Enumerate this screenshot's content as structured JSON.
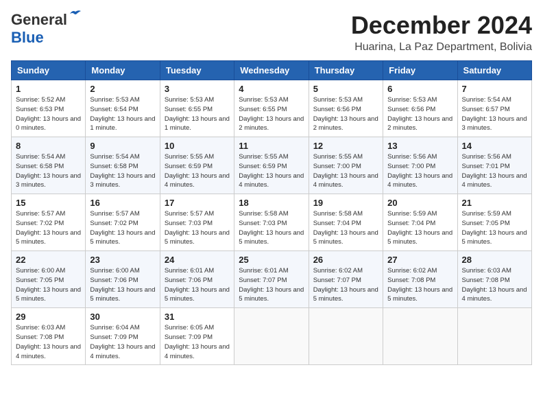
{
  "logo": {
    "line1": "General",
    "line2": "Blue"
  },
  "title": "December 2024",
  "location": "Huarina, La Paz Department, Bolivia",
  "days_of_week": [
    "Sunday",
    "Monday",
    "Tuesday",
    "Wednesday",
    "Thursday",
    "Friday",
    "Saturday"
  ],
  "weeks": [
    [
      {
        "day": "1",
        "sunrise": "5:52 AM",
        "sunset": "6:53 PM",
        "daylight": "13 hours and 0 minutes."
      },
      {
        "day": "2",
        "sunrise": "5:53 AM",
        "sunset": "6:54 PM",
        "daylight": "13 hours and 1 minute."
      },
      {
        "day": "3",
        "sunrise": "5:53 AM",
        "sunset": "6:55 PM",
        "daylight": "13 hours and 1 minute."
      },
      {
        "day": "4",
        "sunrise": "5:53 AM",
        "sunset": "6:55 PM",
        "daylight": "13 hours and 2 minutes."
      },
      {
        "day": "5",
        "sunrise": "5:53 AM",
        "sunset": "6:56 PM",
        "daylight": "13 hours and 2 minutes."
      },
      {
        "day": "6",
        "sunrise": "5:53 AM",
        "sunset": "6:56 PM",
        "daylight": "13 hours and 2 minutes."
      },
      {
        "day": "7",
        "sunrise": "5:54 AM",
        "sunset": "6:57 PM",
        "daylight": "13 hours and 3 minutes."
      }
    ],
    [
      {
        "day": "8",
        "sunrise": "5:54 AM",
        "sunset": "6:58 PM",
        "daylight": "13 hours and 3 minutes."
      },
      {
        "day": "9",
        "sunrise": "5:54 AM",
        "sunset": "6:58 PM",
        "daylight": "13 hours and 3 minutes."
      },
      {
        "day": "10",
        "sunrise": "5:55 AM",
        "sunset": "6:59 PM",
        "daylight": "13 hours and 4 minutes."
      },
      {
        "day": "11",
        "sunrise": "5:55 AM",
        "sunset": "6:59 PM",
        "daylight": "13 hours and 4 minutes."
      },
      {
        "day": "12",
        "sunrise": "5:55 AM",
        "sunset": "7:00 PM",
        "daylight": "13 hours and 4 minutes."
      },
      {
        "day": "13",
        "sunrise": "5:56 AM",
        "sunset": "7:00 PM",
        "daylight": "13 hours and 4 minutes."
      },
      {
        "day": "14",
        "sunrise": "5:56 AM",
        "sunset": "7:01 PM",
        "daylight": "13 hours and 4 minutes."
      }
    ],
    [
      {
        "day": "15",
        "sunrise": "5:57 AM",
        "sunset": "7:02 PM",
        "daylight": "13 hours and 5 minutes."
      },
      {
        "day": "16",
        "sunrise": "5:57 AM",
        "sunset": "7:02 PM",
        "daylight": "13 hours and 5 minutes."
      },
      {
        "day": "17",
        "sunrise": "5:57 AM",
        "sunset": "7:03 PM",
        "daylight": "13 hours and 5 minutes."
      },
      {
        "day": "18",
        "sunrise": "5:58 AM",
        "sunset": "7:03 PM",
        "daylight": "13 hours and 5 minutes."
      },
      {
        "day": "19",
        "sunrise": "5:58 AM",
        "sunset": "7:04 PM",
        "daylight": "13 hours and 5 minutes."
      },
      {
        "day": "20",
        "sunrise": "5:59 AM",
        "sunset": "7:04 PM",
        "daylight": "13 hours and 5 minutes."
      },
      {
        "day": "21",
        "sunrise": "5:59 AM",
        "sunset": "7:05 PM",
        "daylight": "13 hours and 5 minutes."
      }
    ],
    [
      {
        "day": "22",
        "sunrise": "6:00 AM",
        "sunset": "7:05 PM",
        "daylight": "13 hours and 5 minutes."
      },
      {
        "day": "23",
        "sunrise": "6:00 AM",
        "sunset": "7:06 PM",
        "daylight": "13 hours and 5 minutes."
      },
      {
        "day": "24",
        "sunrise": "6:01 AM",
        "sunset": "7:06 PM",
        "daylight": "13 hours and 5 minutes."
      },
      {
        "day": "25",
        "sunrise": "6:01 AM",
        "sunset": "7:07 PM",
        "daylight": "13 hours and 5 minutes."
      },
      {
        "day": "26",
        "sunrise": "6:02 AM",
        "sunset": "7:07 PM",
        "daylight": "13 hours and 5 minutes."
      },
      {
        "day": "27",
        "sunrise": "6:02 AM",
        "sunset": "7:08 PM",
        "daylight": "13 hours and 5 minutes."
      },
      {
        "day": "28",
        "sunrise": "6:03 AM",
        "sunset": "7:08 PM",
        "daylight": "13 hours and 4 minutes."
      }
    ],
    [
      {
        "day": "29",
        "sunrise": "6:03 AM",
        "sunset": "7:08 PM",
        "daylight": "13 hours and 4 minutes."
      },
      {
        "day": "30",
        "sunrise": "6:04 AM",
        "sunset": "7:09 PM",
        "daylight": "13 hours and 4 minutes."
      },
      {
        "day": "31",
        "sunrise": "6:05 AM",
        "sunset": "7:09 PM",
        "daylight": "13 hours and 4 minutes."
      },
      null,
      null,
      null,
      null
    ]
  ]
}
